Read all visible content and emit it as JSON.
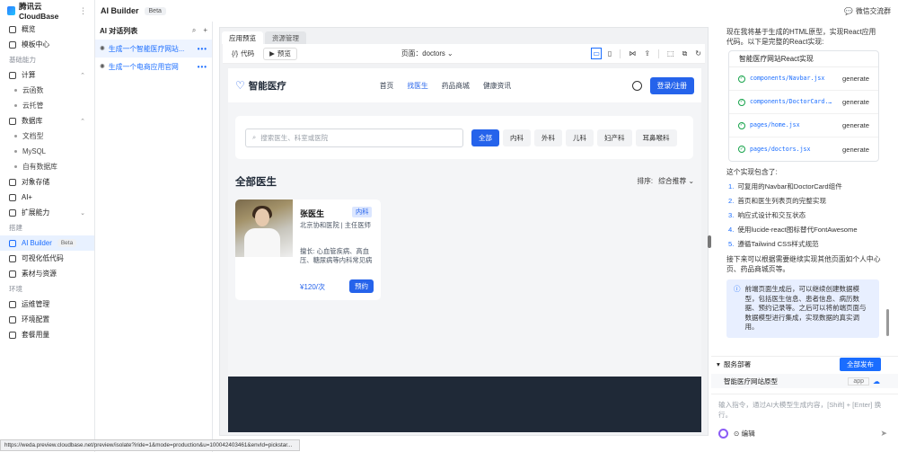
{
  "app": {
    "logo_text": "腾讯云CloudBase",
    "title": "AI Builder",
    "beta": "Beta",
    "right_link": "微信交流群"
  },
  "sidebar": {
    "items": [
      {
        "label": "概览",
        "type": "item"
      },
      {
        "label": "模板中心",
        "type": "item"
      },
      {
        "label": "基础能力",
        "type": "section"
      },
      {
        "label": "计算",
        "type": "item",
        "chev": "^"
      },
      {
        "label": "云函数",
        "type": "sub"
      },
      {
        "label": "云托管",
        "type": "sub"
      },
      {
        "label": "数据库",
        "type": "item",
        "chev": "^"
      },
      {
        "label": "文档型",
        "type": "sub"
      },
      {
        "label": "MySQL",
        "type": "sub"
      },
      {
        "label": "自有数据库",
        "type": "sub"
      },
      {
        "label": "对象存储",
        "type": "item"
      },
      {
        "label": "AI+",
        "type": "item"
      },
      {
        "label": "扩展能力",
        "type": "item",
        "chev": "v"
      },
      {
        "label": "搭建",
        "type": "section"
      },
      {
        "label": "AI Builder",
        "type": "item",
        "active": true,
        "badge": "Beta"
      },
      {
        "label": "可视化低代码",
        "type": "item"
      },
      {
        "label": "素材与资源",
        "type": "item"
      },
      {
        "label": "环境",
        "type": "section"
      },
      {
        "label": "运维管理",
        "type": "item"
      },
      {
        "label": "环境配置",
        "type": "item"
      },
      {
        "label": "套餐用量",
        "type": "item"
      }
    ]
  },
  "convlist": {
    "title": "AI 对话列表",
    "items": [
      {
        "label": "生成一个智能医疗网站...",
        "active": true
      },
      {
        "label": "生成一个电商应用官网",
        "active": false
      }
    ]
  },
  "preview": {
    "tabs": [
      "应用预览",
      "资源管理"
    ],
    "toolbar": {
      "code_btn": "代码",
      "preview_btn": "预览",
      "page_label": "页面：doctors"
    }
  },
  "site": {
    "brand": "智能医疗",
    "menu": [
      "首页",
      "找医生",
      "药品商城",
      "健康资讯"
    ],
    "menu_active_index": 1,
    "login": "登录/注册",
    "search_placeholder": "搜索医生、科室或医院",
    "chips": [
      "全部",
      "内科",
      "外科",
      "儿科",
      "妇产科",
      "耳鼻喉科"
    ],
    "section_title": "全部医生",
    "sort_label": "排序:",
    "sort_value": "综合推荐",
    "doctor": {
      "name": "张医生",
      "dept": "内科",
      "hospital": "北京协和医院 | 主任医师",
      "specialty": "擅长: 心血管疾病、高血压、糖尿病等内科常见病",
      "price": "¥120/次",
      "book": "预约"
    }
  },
  "chat": {
    "intro": "现在我将基于生成的HTML原型，实现React应用代码。以下是完整的React实现:",
    "react_box_title": "智能医疗网站React实现",
    "files": [
      {
        "path": "components/Navbar.jsx",
        "status": "generate"
      },
      {
        "path": "components/DoctorCard.jsx",
        "status": "generate"
      },
      {
        "path": "pages/home.jsx",
        "status": "generate"
      },
      {
        "path": "pages/doctors.jsx",
        "status": "generate"
      }
    ],
    "contains": "这个实现包含了:",
    "list": [
      "可复用的Navbar和DoctorCard组件",
      "首页和医生列表页的完整实现",
      "响应式设计和交互状态",
      "使用lucide-react图标替代FontAwesome",
      "遵循Tailwind CSS样式规范"
    ],
    "followup": "接下来可以根据需要继续实现其他页面如个人中心页、药品商城页等。",
    "info": "前端页面生成后，可以继续创建数据模型，包括医生信息、患者信息、病历数据、预约记录等。之后可以将前端页面与数据模型进行集成，实现数据的真实调用。",
    "deploy_title": "服务部署",
    "deploy_btn": "全部发布",
    "deploy_item": "智能医疗网站原型",
    "deploy_tag": "app",
    "input_placeholder": "输入指令，通过AI大模型生成内容，[Shift] + [Enter] 换行。",
    "edit": "编辑"
  },
  "status_url": "https://weda.preview.cloudbase.net/preview/isolate?iride=1&mode=production&u=100042403461&envId=pickstar..."
}
